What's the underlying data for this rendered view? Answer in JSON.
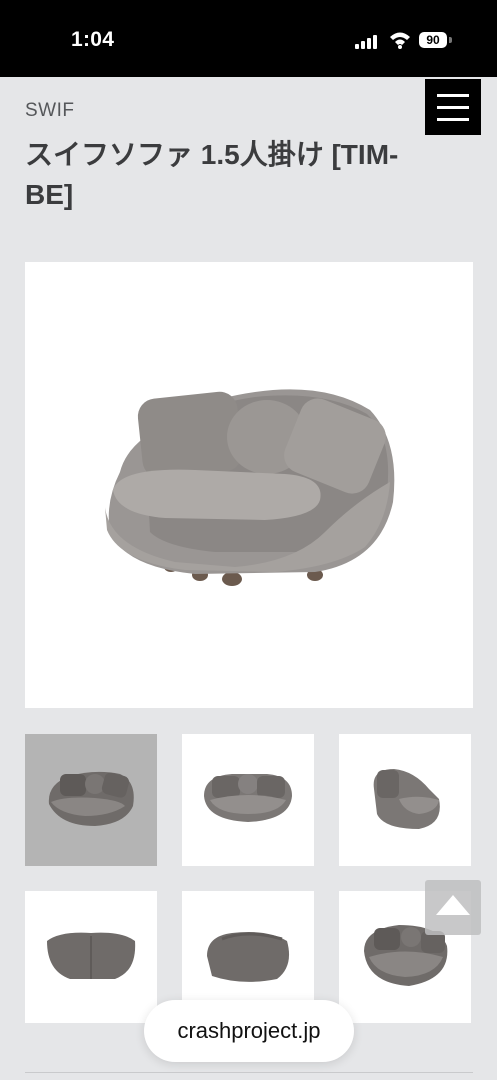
{
  "status_bar": {
    "time": "1:04",
    "battery": "90"
  },
  "product": {
    "brand": "SWIF",
    "title": "スイフソファ 1.5人掛け [TIM-BE]"
  },
  "gallery": {
    "main": {
      "view": "front-angle"
    },
    "thumbnails": [
      {
        "view": "front-angle",
        "selected": true
      },
      {
        "view": "front"
      },
      {
        "view": "side"
      },
      {
        "view": "back"
      },
      {
        "view": "back-angle"
      },
      {
        "view": "top-angle"
      }
    ]
  },
  "browser": {
    "url": "crashproject.jp"
  },
  "icons": [
    "signal-icon",
    "wifi-icon",
    "battery-icon",
    "menu-icon",
    "arrow-up-icon"
  ],
  "colors": {
    "status_bar": "#000000",
    "page_bg": "#e5e6e8",
    "sofa": "#8e8a88",
    "active_thumb": "#b4b4b4"
  }
}
